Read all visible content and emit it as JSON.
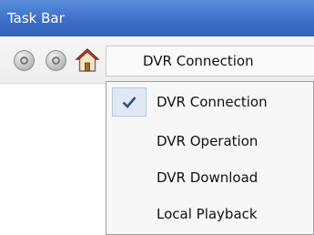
{
  "window": {
    "title": "Task Bar"
  },
  "toolbar": {
    "selected_value": "DVR Connection",
    "buttons": [
      {
        "icon": "back-icon"
      },
      {
        "icon": "forward-icon"
      },
      {
        "icon": "home-icon"
      }
    ]
  },
  "dropdown": {
    "items": [
      {
        "label": "DVR Connection",
        "checked": true
      },
      {
        "label": "DVR Operation",
        "checked": false
      },
      {
        "label": "DVR Download",
        "checked": false
      },
      {
        "label": "Local Playback",
        "checked": false
      }
    ]
  },
  "colors": {
    "titlebar": "#3d6fc7",
    "titlebar_text": "#ffffff",
    "check_highlight": "#dfe8f3",
    "check_mark": "#2f4f86"
  }
}
